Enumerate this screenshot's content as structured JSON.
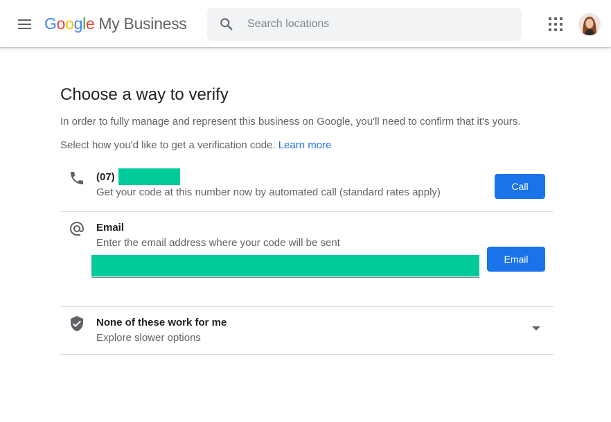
{
  "header": {
    "logo_google": [
      "G",
      "o",
      "o",
      "g",
      "l",
      "e"
    ],
    "logo_product": "My Business",
    "search_placeholder": "Search locations"
  },
  "main": {
    "title": "Choose a way to verify",
    "description": "In order to fully manage and represent this business on Google, you'll need to confirm that it's yours.",
    "select_prefix": "Select how you'd like to get a verification code.",
    "learn_more": "Learn more",
    "options": [
      {
        "icon": "phone-icon",
        "title": "(07)",
        "subtitle": "Get your code at this number now by automated call (standard rates apply)",
        "button": "Call"
      },
      {
        "icon": "at-sign-icon",
        "title": "Email",
        "subtitle": "Enter the email address where your code will be sent",
        "button": "Email"
      },
      {
        "icon": "shield-check-icon",
        "title": "None of these work for me",
        "subtitle": "Explore slower options"
      }
    ]
  },
  "colors": {
    "accent": "#1a73e8",
    "redaction": "#00c99a"
  }
}
